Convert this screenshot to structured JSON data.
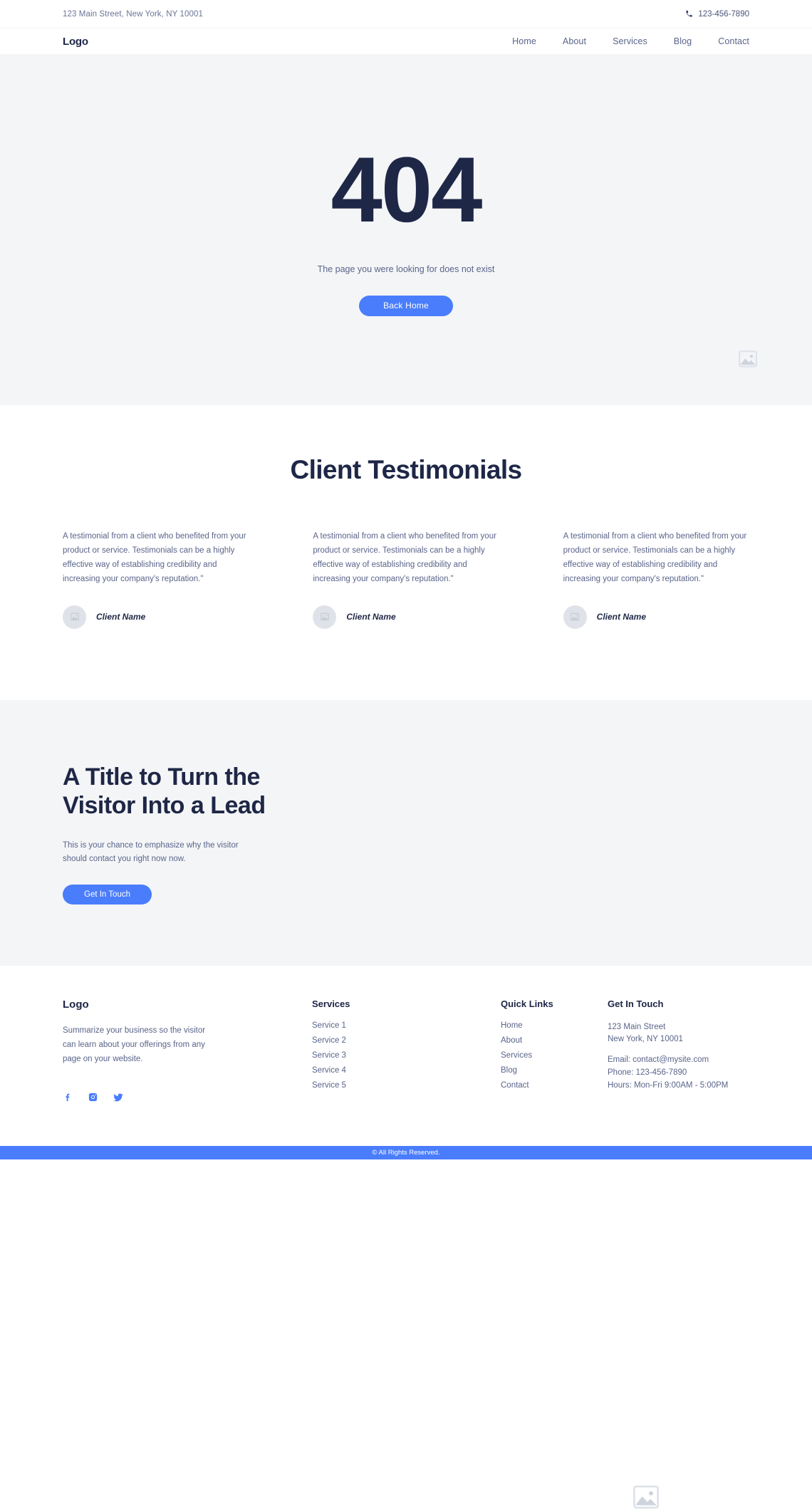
{
  "topbar": {
    "address": "123 Main Street, New York, NY 10001",
    "phone": "123-456-7890",
    "phone_icon": "phone-icon"
  },
  "nav": {
    "logo": "Logo",
    "links": [
      {
        "label": "Home"
      },
      {
        "label": "About"
      },
      {
        "label": "Services"
      },
      {
        "label": "Blog"
      },
      {
        "label": "Contact"
      }
    ]
  },
  "hero": {
    "code": "404",
    "subtitle": "The page you were looking for does not exist",
    "button": "Back Home",
    "image_placeholder_icon": "image-placeholder-icon"
  },
  "testimonials": {
    "title": "Client Testimonials",
    "items": [
      {
        "quote": "A testimonial from a client who benefited from your product or service. Testimonials can be a highly effective way of establishing credibility and increasing your company's reputation.\"",
        "name": "Client Name"
      },
      {
        "quote": "A testimonial from a client who benefited from your product or service. Testimonials can be a highly effective way of establishing credibility and increasing your company's reputation.\"",
        "name": "Client Name"
      },
      {
        "quote": "A testimonial from a client who benefited from your product or service. Testimonials can be a highly effective way of establishing credibility and increasing your company's reputation.\"",
        "name": "Client Name"
      }
    ]
  },
  "cta": {
    "title_line1": "A Title to Turn the",
    "title_line2": "Visitor Into a Lead",
    "subtitle": "This is your chance to emphasize why the visitor should contact you right now now.",
    "button": "Get In Touch",
    "image_placeholder_icon": "image-placeholder-icon"
  },
  "footer": {
    "logo": "Logo",
    "description": "Summarize your business so the visitor can learn about your offerings from any page on your website.",
    "socials": [
      {
        "name": "facebook-icon"
      },
      {
        "name": "instagram-icon"
      },
      {
        "name": "twitter-icon"
      }
    ],
    "services": {
      "heading": "Services",
      "items": [
        {
          "label": "Service 1"
        },
        {
          "label": "Service 2"
        },
        {
          "label": "Service 3"
        },
        {
          "label": "Service 4"
        },
        {
          "label": "Service 5"
        }
      ]
    },
    "quick_links": {
      "heading": "Quick Links",
      "items": [
        {
          "label": "Home"
        },
        {
          "label": "About"
        },
        {
          "label": "Services"
        },
        {
          "label": "Blog"
        },
        {
          "label": "Contact"
        }
      ]
    },
    "get_in_touch": {
      "heading": "Get In Touch",
      "address_line1": "123 Main Street",
      "address_line2": "New York, NY 10001",
      "email": "Email: contact@mysite.com",
      "phone": "Phone: 123-456-7890",
      "hours": "Hours: Mon-Fri 9:00AM - 5:00PM"
    }
  },
  "bottombar": {
    "copyright": "© All Rights Reserved."
  },
  "colors": {
    "accent": "#4a7dfc",
    "dark": "#1e2746",
    "muted": "#5a648a",
    "section_bg": "#f4f5f7"
  }
}
